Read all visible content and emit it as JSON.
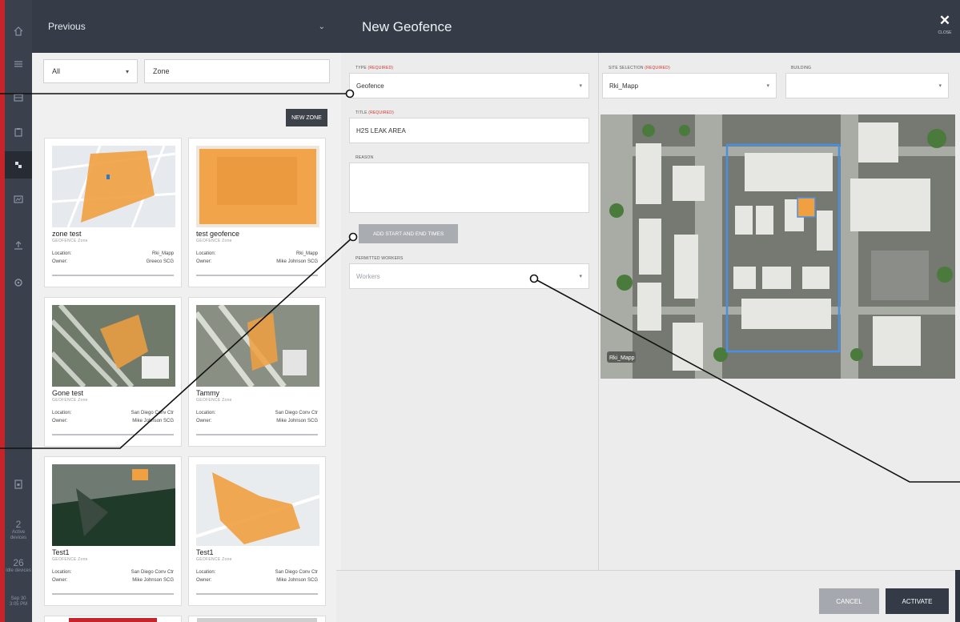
{
  "sidebar": {
    "icons": [
      "home-icon",
      "list-icon",
      "grid-icon",
      "clipboard-icon",
      "geofence-icon",
      "chart-icon",
      "upload-icon",
      "settings-icon",
      "lock-icon"
    ],
    "stats": [
      {
        "value": "2",
        "label": "Active devices"
      },
      {
        "value": "26",
        "label": "Idle devices"
      }
    ],
    "timestamp": "Sep 30 3:05 PM"
  },
  "previous_panel": {
    "header": "Previous",
    "filter_select": "All",
    "search_value": "Zone",
    "new_zone_label": "NEW ZONE",
    "location_label": "Location:",
    "owner_label": "Owner:",
    "zones": [
      {
        "name": "zone test",
        "type": "GEOFENCE Zone",
        "location": "Rki_Mapp",
        "owner": "Greeco SCG"
      },
      {
        "name": "test geofence",
        "type": "GEOFENCE Zone",
        "location": "Rki_Mapp",
        "owner": "Mike Johnson SCG"
      },
      {
        "name": "Gone test",
        "type": "GEOFENCE Zone",
        "location": "San Diego Conv Ctr",
        "owner": "Mike Johnson SCG"
      },
      {
        "name": "Tammy",
        "type": "GEOFENCE Zone",
        "location": "San Diego Conv Ctr",
        "owner": "Mike Johnson SCG"
      },
      {
        "name": "Test1",
        "type": "GEOFENCE Zone",
        "location": "San Diego Conv Ctr",
        "owner": "Mike Johnson SCG"
      },
      {
        "name": "Test1",
        "type": "GEOFENCE Zone",
        "location": "San Diego Conv Ctr",
        "owner": "Mike Johnson SCG"
      }
    ]
  },
  "modal": {
    "title": "New Geofence",
    "close_label": "CLOSE",
    "required_tag": "(REQUIRED)",
    "type_label": "TYPE",
    "type_value": "Geofence",
    "title_label": "TITLE",
    "title_value": "H2S LEAK AREA",
    "reason_label": "REASON",
    "times_button": "ADD START AND END TIMES",
    "workers_label": "PERMITTED WORKERS",
    "workers_placeholder": "Workers",
    "site_label": "SITE SELECTION",
    "site_value": "Rki_Mapp",
    "building_label": "BUILDING",
    "building_value": "",
    "map_tag": "Rki_Mapp",
    "cancel_label": "CANCEL",
    "activate_label": "ACTIVATE"
  },
  "colors": {
    "brand_red": "#c4242a",
    "header_dark": "#353c48",
    "geofence_orange": "#f0a040",
    "map_outline": "#4a90e2"
  }
}
